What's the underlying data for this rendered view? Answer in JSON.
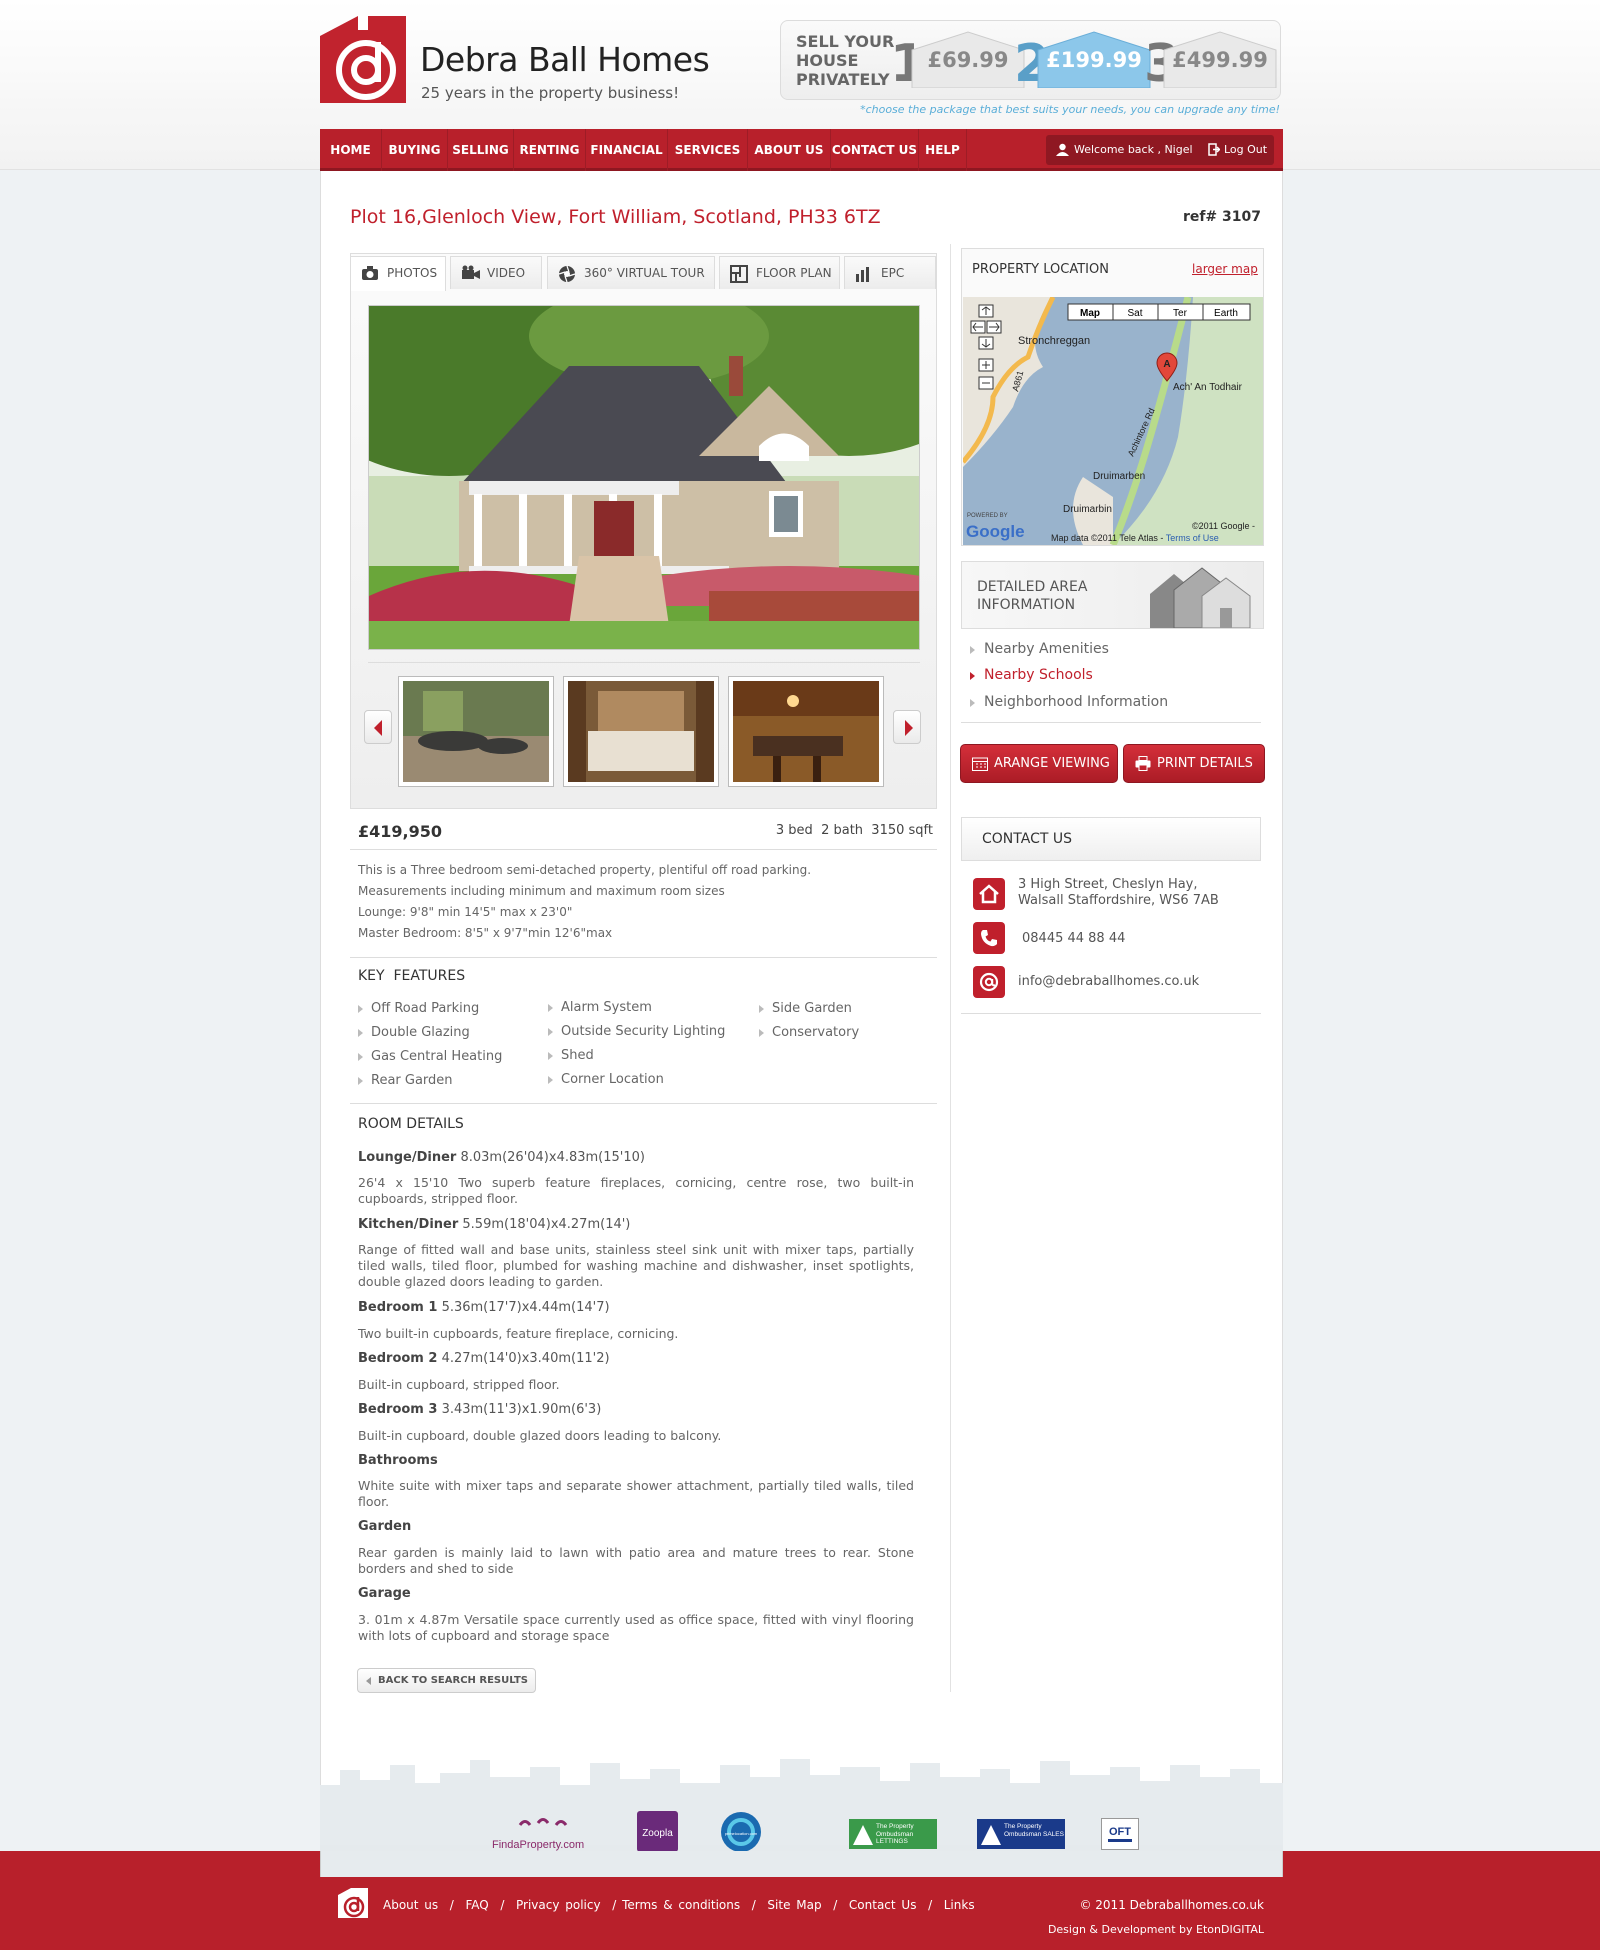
{
  "brand": {
    "name": "Debra Ball Homes",
    "tagline": "25 years in the property business!"
  },
  "sell_panel": {
    "heading": "SELL YOUR HOUSE PRIVATELY",
    "packages": [
      {
        "number": "1",
        "price": "£69.99"
      },
      {
        "number": "2",
        "price": "£199.99"
      },
      {
        "number": "3",
        "price": "£499.99"
      }
    ],
    "note": "*choose the package that best suits your needs, you can upgrade any time!"
  },
  "nav": {
    "items": [
      "HOME",
      "BUYING",
      "SELLING",
      "RENTING",
      "FINANCIAL",
      "SERVICES",
      "ABOUT US",
      "CONTACT US",
      "HELP"
    ],
    "welcome": "Welcome back , Nigel",
    "logout": "Log Out"
  },
  "property": {
    "title": "Plot 16,Glenloch View, Fort William, Scotland, PH33 6TZ",
    "ref": "ref# 3107",
    "price": "£419,950",
    "specs": "3 bed  2 bath  3150 sqft",
    "description": [
      "This is a Three bedroom semi-detached property, plentiful off road parking.",
      "Measurements including minimum and maximum room sizes",
      "Lounge: 9'8\" min 14'5\" max x 23'0\"",
      "Master Bedroom: 8'5\" x 9'7\"min 12'6\"max"
    ]
  },
  "media_tabs": [
    "PHOTOS",
    "VIDEO",
    "360° VIRTUAL TOUR",
    "FLOOR PLAN",
    "EPC"
  ],
  "key_features": {
    "title": "KEY  FEATURES",
    "columns": [
      [
        "Off Road Parking",
        "Double Glazing",
        "Gas Central Heating",
        "Rear Garden"
      ],
      [
        "Alarm System",
        "Outside Security Lighting",
        "Shed",
        "Corner Location"
      ],
      [
        "Side Garden",
        "Conservatory"
      ]
    ]
  },
  "rooms": {
    "title": "ROOM DETAILS",
    "items": [
      {
        "name": "Lounge/Diner",
        "size": "8.03m(26'04)x4.83m(15'10)",
        "desc": "26'4 x 15'10 Two superb feature fireplaces, cornicing, centre rose, two built-in cupboards, stripped floor."
      },
      {
        "name": "Kitchen/Diner",
        "size": "5.59m(18'04)x4.27m(14')",
        "desc": "Range of fitted wall and base units, stainless steel sink unit with mixer taps, partially tiled walls, tiled floor, plumbed for washing machine and dishwasher, inset spotlights, double glazed doors leading to garden."
      },
      {
        "name": "Bedroom 1",
        "size": "5.36m(17'7)x4.44m(14'7)",
        "desc": "Two built-in cupboards, feature fireplace, cornicing."
      },
      {
        "name": "Bedroom 2",
        "size": "4.27m(14'0)x3.40m(11'2)",
        "desc": "Built-in cupboard, stripped floor."
      },
      {
        "name": "Bedroom 3",
        "size": "3.43m(11'3)x1.90m(6'3)",
        "desc": "Built-in cupboard, double glazed doors leading to balcony."
      },
      {
        "name": "Bathrooms",
        "size": "",
        "desc": "White suite with mixer taps and separate shower attachment, partially tiled walls, tiled floor."
      },
      {
        "name": "Garden",
        "size": "",
        "desc": "Rear garden is mainly laid to lawn with patio area and mature trees to rear. Stone borders and shed to side"
      },
      {
        "name": "Garage",
        "size": "",
        "desc": "3. 01m x 4.87m Versatile space currently used as office space, fitted with vinyl flooring with lots of cupboard and storage space"
      }
    ]
  },
  "back_button": "BACK TO SEARCH RESULTS",
  "location": {
    "title": "PROPERTY LOCATION",
    "larger_map": "larger map",
    "map_types": [
      "Map",
      "Sat",
      "Ter",
      "Earth"
    ],
    "places": [
      "Stronchreggan",
      "Ach' An Todhair",
      "Druimarben",
      "Druimarbin"
    ],
    "road_labels": [
      "A861",
      "Achintore Rd"
    ],
    "marker": "A",
    "powered_by": "POWERED BY",
    "google": "Google",
    "copyright": "©2011 Google -",
    "map_data": "Map data ©2011 Tele Atlas - ",
    "terms": "Terms of Use"
  },
  "area_info": {
    "title": "DETAILED AREA INFORMATION",
    "links": [
      "Nearby Amenities",
      "Nearby Schools",
      "Neighborhood Information"
    ]
  },
  "actions": {
    "arrange": "ARANGE VIEWING",
    "print": "PRINT DETAILS"
  },
  "contact": {
    "title": "CONTACT US",
    "address": [
      "3 High Street, Cheslyn Hay,",
      "Walsall Staffordshire, WS6 7AB"
    ],
    "phone": "08445 44 88 44",
    "email": "info@debraballhomes.co.uk"
  },
  "partners": [
    "FindaProperty.com",
    "Zoopla",
    "primelocation.com",
    "The Property Ombudsman LETTINGS",
    "The Property Ombudsman SALES",
    "OFT"
  ],
  "footer": {
    "links": "About us  /  FAQ  /  Privacy policy  / Terms & conditions  /  Site Map  /  Contact Us  /  Links",
    "copyright": "© 2011 Debraballhomes.co.uk",
    "credits": "Design & Development by EtonDIGITAL"
  },
  "colors": {
    "brand_red": "#b8202b",
    "accent_blue": "#5aaed8"
  }
}
